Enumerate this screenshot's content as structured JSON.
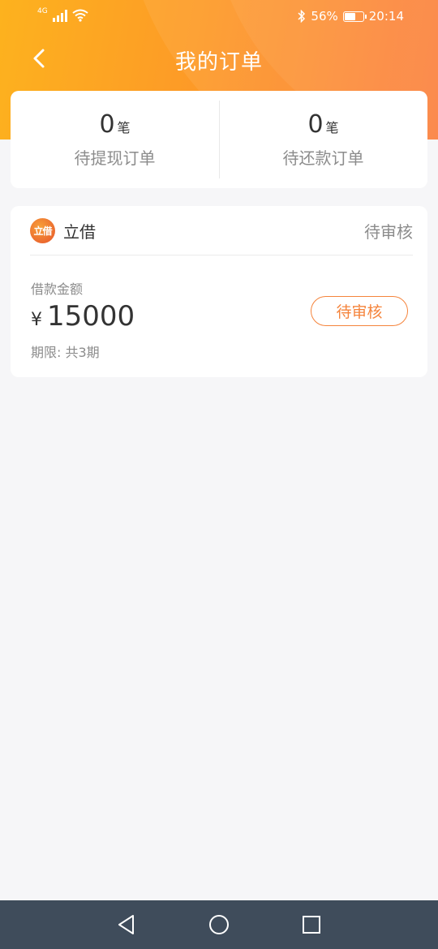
{
  "status_bar": {
    "network": "4G",
    "battery_percent": "56%",
    "time": "20:14"
  },
  "nav": {
    "title": "我的订单",
    "back_icon": "chevron-left-icon"
  },
  "summary": {
    "pending_withdraw": {
      "count": "0",
      "unit": "笔",
      "label": "待提现订单"
    },
    "pending_repay": {
      "count": "0",
      "unit": "笔",
      "label": "待还款订单"
    }
  },
  "order": {
    "brand_logo_text": "立借",
    "brand_name": "立借",
    "status": "待审核",
    "amount_label": "借款金额",
    "currency": "¥",
    "amount": "15000",
    "period": "期限: 共3期",
    "status_button": "待审核"
  },
  "colors": {
    "accent": "#f5843c",
    "header_start": "#fdb21e",
    "header_end": "#fb7a35",
    "nav_bar": "#3f4c5b"
  }
}
